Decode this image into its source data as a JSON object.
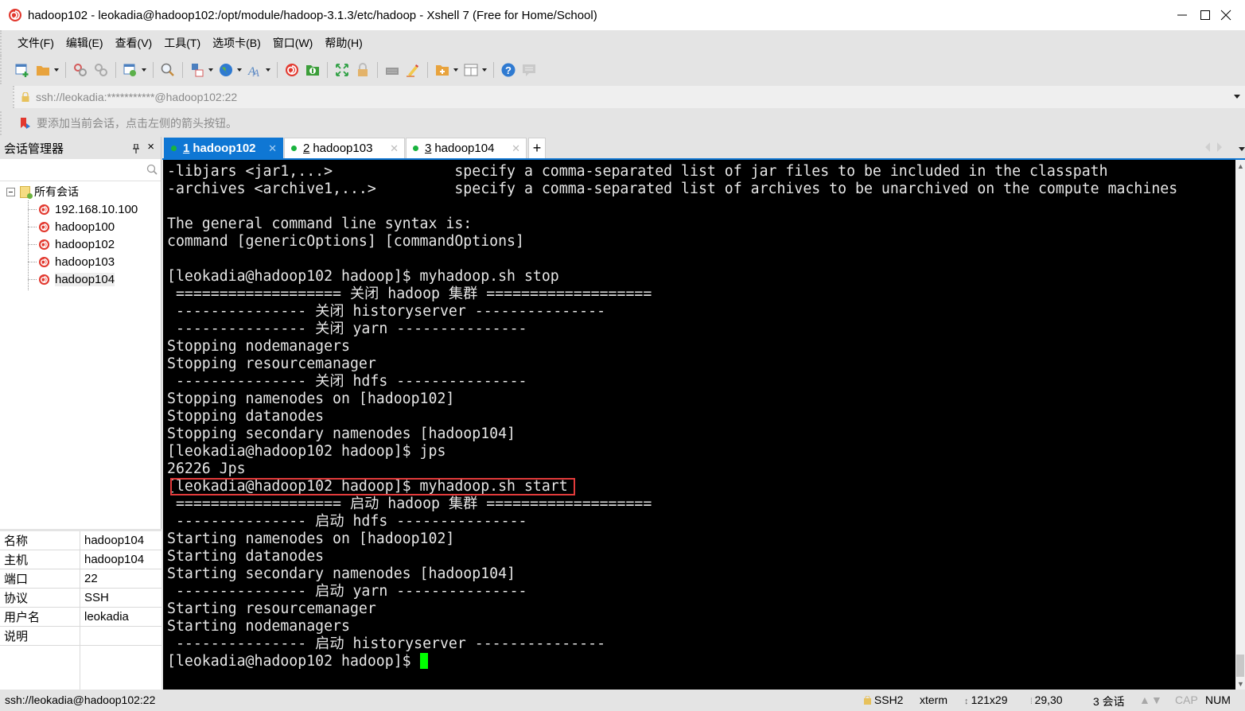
{
  "window": {
    "title": "hadoop102 - leokadia@hadoop102:/opt/module/hadoop-3.1.3/etc/hadoop - Xshell 7 (Free for Home/School)",
    "minimize_icon": "minimize-icon",
    "maximize_icon": "maximize-icon",
    "close_icon": "close-icon"
  },
  "menu": [
    {
      "label": "文件(F)"
    },
    {
      "label": "编辑(E)"
    },
    {
      "label": "查看(V)"
    },
    {
      "label": "工具(T)"
    },
    {
      "label": "选项卡(B)"
    },
    {
      "label": "窗口(W)"
    },
    {
      "label": "帮助(H)"
    }
  ],
  "toolbar": [
    {
      "icon": "new-session-icon",
      "dropdown": false
    },
    {
      "icon": "open-folder-icon",
      "dropdown": true
    },
    {
      "icon": "reconnect-icon",
      "dropdown": false
    },
    {
      "icon": "disconnect-icon",
      "dropdown": false
    },
    {
      "icon": "properties-icon",
      "dropdown": true
    },
    {
      "icon": "search-icon",
      "dropdown": false
    },
    {
      "icon": "transfer-icon",
      "dropdown": true
    },
    {
      "icon": "globe-icon",
      "dropdown": true
    },
    {
      "icon": "font-icon",
      "dropdown": true
    },
    {
      "icon": "xshell-icon",
      "dropdown": false
    },
    {
      "icon": "xftp-icon",
      "dropdown": false
    },
    {
      "icon": "fullscreen-icon",
      "dropdown": false
    },
    {
      "icon": "lock-icon",
      "dropdown": false
    },
    {
      "icon": "keyboard-icon",
      "dropdown": false
    },
    {
      "icon": "highlight-pen-icon",
      "dropdown": false
    },
    {
      "icon": "new-folder-icon",
      "dropdown": true
    },
    {
      "icon": "layout-icon",
      "dropdown": true
    },
    {
      "icon": "help-icon",
      "dropdown": false
    },
    {
      "icon": "chat-icon",
      "dropdown": false
    }
  ],
  "address": {
    "value": "ssh://leokadia:***********@hadoop102:22"
  },
  "hint": {
    "text": "要添加当前会话，点击左侧的箭头按钮。"
  },
  "session_manager": {
    "title": "会话管理器",
    "pin_label": "ᚼ",
    "close_label": "×",
    "search_placeholder": "",
    "root_label": "所有会话",
    "sessions": [
      {
        "label": "192.168.10.100",
        "selected": false
      },
      {
        "label": "hadoop100",
        "selected": false
      },
      {
        "label": "hadoop102",
        "selected": false
      },
      {
        "label": "hadoop103",
        "selected": false
      },
      {
        "label": "hadoop104",
        "selected": true
      }
    ]
  },
  "properties": [
    {
      "key": "名称",
      "value": "hadoop104"
    },
    {
      "key": "主机",
      "value": "hadoop104"
    },
    {
      "key": "端口",
      "value": "22"
    },
    {
      "key": "协议",
      "value": "SSH"
    },
    {
      "key": "用户名",
      "value": "leokadia"
    },
    {
      "key": "说明",
      "value": ""
    }
  ],
  "tabs": [
    {
      "num": "1",
      "label": "hadoop102",
      "active": true,
      "status_color": "#19b33e"
    },
    {
      "num": "2",
      "label": "hadoop103",
      "active": false,
      "status_color": "#19b33e"
    },
    {
      "num": "3",
      "label": "hadoop104",
      "active": false,
      "status_color": "#19b33e"
    }
  ],
  "tab_add_label": "+",
  "terminal": {
    "lines": [
      "-libjars <jar1,...>              specify a comma-separated list of jar files to be included in the classpath",
      "-archives <archive1,...>         specify a comma-separated list of archives to be unarchived on the compute machines",
      "",
      "The general command line syntax is:",
      "command [genericOptions] [commandOptions]",
      "",
      "[leokadia@hadoop102 hadoop]$ myhadoop.sh stop",
      " =================== 关闭 hadoop 集群 ===================",
      " --------------- 关闭 historyserver ---------------",
      " --------------- 关闭 yarn ---------------",
      "Stopping nodemanagers",
      "Stopping resourcemanager",
      " --------------- 关闭 hdfs ---------------",
      "Stopping namenodes on [hadoop102]",
      "Stopping datanodes",
      "Stopping secondary namenodes [hadoop104]",
      "[leokadia@hadoop102 hadoop]$ jps",
      "26226 Jps",
      "[leokadia@hadoop102 hadoop]$ myhadoop.sh start",
      " =================== 启动 hadoop 集群 ===================",
      " --------------- 启动 hdfs ---------------",
      "Starting namenodes on [hadoop102]",
      "Starting datanodes",
      "Starting secondary namenodes [hadoop104]",
      " --------------- 启动 yarn ---------------",
      "Starting resourcemanager",
      "Starting nodemanagers",
      " --------------- 启动 historyserver ---------------"
    ],
    "prompt": "[leokadia@hadoop102 hadoop]$ ",
    "highlight_color": "#e33b3b",
    "cursor_color": "#00ff00"
  },
  "statusbar": {
    "connection": "ssh://leokadia@hadoop102:22",
    "protocol": "SSH2",
    "term_type": "xterm",
    "size": "121x29",
    "cursor_pos": "29,30",
    "sessions": "3 会话",
    "cap": "CAP",
    "num": "NUM"
  }
}
